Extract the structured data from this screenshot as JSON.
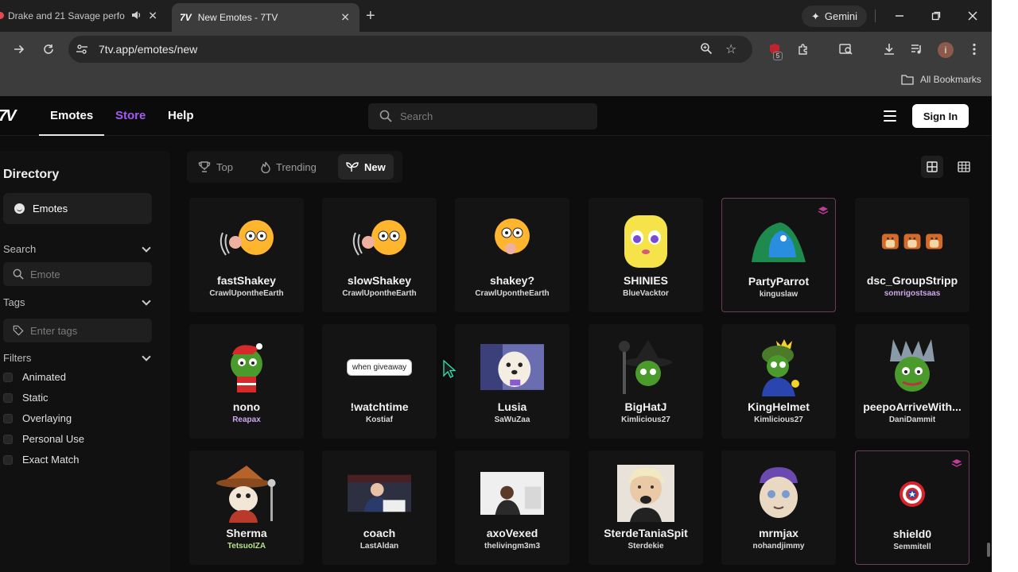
{
  "browser": {
    "tabs": [
      {
        "label": "Drake and 21 Savage perfo",
        "active": false,
        "audio": true
      },
      {
        "label": "New Emotes - 7TV",
        "active": true
      }
    ],
    "gemini_label": "Gemini",
    "url": "7tv.app/emotes/new",
    "extension_badge": "5",
    "profile_initial": "i",
    "bookmarks_label": "All Bookmarks"
  },
  "header": {
    "nav": {
      "emotes": "Emotes",
      "store": "Store",
      "help": "Help"
    },
    "search_placeholder": "Search",
    "sign_in": "Sign In",
    "store_color": "#a25cf0"
  },
  "sidebar": {
    "title": "Directory",
    "directory_item": "Emotes",
    "search_label": "Search",
    "search_placeholder": "Emote",
    "tags_label": "Tags",
    "tags_placeholder": "Enter tags",
    "filters_label": "Filters",
    "filters": [
      "Animated",
      "Static",
      "Overlaying",
      "Personal Use",
      "Exact Match"
    ]
  },
  "sort": {
    "options": [
      {
        "label": "Top",
        "icon": "trophy-icon"
      },
      {
        "label": "Trending",
        "icon": "flame-icon"
      },
      {
        "label": "New",
        "icon": "sprout-icon",
        "active": true
      }
    ]
  },
  "emotes": [
    {
      "name": "fastShakey",
      "owner": "CrawlUpontheEarth",
      "owner_color": "#d8d8d8"
    },
    {
      "name": "slowShakey",
      "owner": "CrawlUpontheEarth",
      "owner_color": "#d8d8d8"
    },
    {
      "name": "shakey?",
      "owner": "CrawlUpontheEarth",
      "owner_color": "#d8d8d8"
    },
    {
      "name": "SHINIES",
      "owner": "BlueVacktor",
      "owner_color": "#d8d8d8"
    },
    {
      "name": "PartyParrot",
      "owner": "kinguslaw",
      "owner_color": "#d8d8d8",
      "subscriber": true
    },
    {
      "name": "dsc_GroupStripp",
      "owner": "somrigostsaas",
      "owner_color": "#c9a8e8"
    },
    {
      "name": "nono",
      "owner": "Reapax",
      "owner_color": "#c9a8e8"
    },
    {
      "name": "!watchtime",
      "owner": "Kostiaf",
      "owner_color": "#d8d8d8"
    },
    {
      "name": "Lusia",
      "owner": "SaWuZaa",
      "owner_color": "#d8d8d8"
    },
    {
      "name": "BigHatJ",
      "owner": "Kimlicious27",
      "owner_color": "#d8d8d8"
    },
    {
      "name": "KingHelmet",
      "owner": "Kimlicious27",
      "owner_color": "#d8d8d8"
    },
    {
      "name": "peepoArriveWith...",
      "owner": "DaniDammit",
      "owner_color": "#d8d8d8"
    },
    {
      "name": "Sherma",
      "owner": "TetsuoIZA",
      "owner_color": "#b6e28a"
    },
    {
      "name": "coach",
      "owner": "LastAldan",
      "owner_color": "#d8d8d8"
    },
    {
      "name": "axoVexed",
      "owner": "thelivingm3m3",
      "owner_color": "#d8d8d8"
    },
    {
      "name": "SterdeTaniaSpit",
      "owner": "Sterdekie",
      "owner_color": "#d8d8d8"
    },
    {
      "name": "mrmjax",
      "owner": "nohandjimmy",
      "owner_color": "#d8d8d8"
    },
    {
      "name": "shield0",
      "owner": "Semmitell",
      "owner_color": "#d8d8d8",
      "subscriber": true
    }
  ],
  "emote_captions": {
    "watchtime_bubble": "when giveaway"
  }
}
